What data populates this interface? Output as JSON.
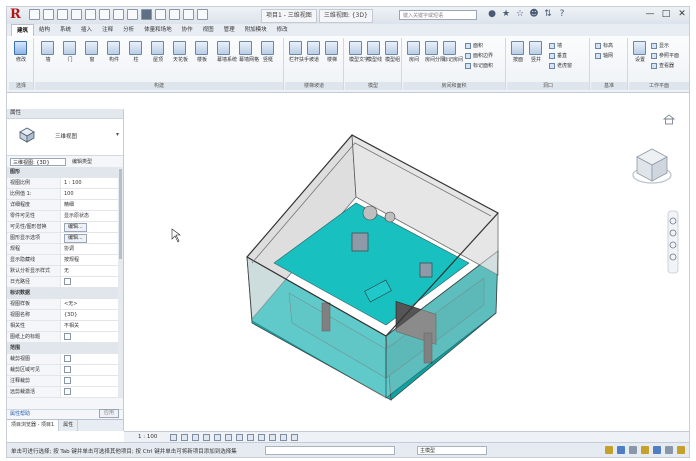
{
  "window": {
    "title_tabs": [
      "项目1 - 三维视图",
      "三维视图: {3D}"
    ],
    "search_placeholder": "键入关键字或短语",
    "user": "登录"
  },
  "ribbon": {
    "tabs": [
      "建筑",
      "结构",
      "系统",
      "插入",
      "注释",
      "分析",
      "体量和场地",
      "协作",
      "视图",
      "管理",
      "附加模块",
      "修改"
    ],
    "active_tab": "建筑",
    "groups": [
      {
        "label": "选择",
        "buttons": [
          "修改"
        ]
      },
      {
        "label": "构建",
        "buttons": [
          "墙",
          "门",
          "窗",
          "构件",
          "柱",
          "屋顶",
          "天花板",
          "楼板",
          "幕墙系统",
          "幕墙网格",
          "竖梃"
        ]
      },
      {
        "label": "楼梯坡道",
        "buttons": [
          "栏杆扶手",
          "坡道",
          "楼梯"
        ]
      },
      {
        "label": "模型",
        "buttons": [
          "模型文字",
          "模型线",
          "模型组"
        ]
      },
      {
        "label": "房间和面积",
        "buttons": [
          "房间",
          "房间分隔",
          "标记房间",
          "面积",
          "面积边界",
          "标记面积"
        ]
      },
      {
        "label": "洞口",
        "buttons": [
          "按面",
          "竖井",
          "墙",
          "垂直",
          "老虎窗"
        ]
      },
      {
        "label": "基准",
        "buttons": [
          "标高",
          "轴网"
        ]
      },
      {
        "label": "工作平面",
        "buttons": [
          "设置",
          "显示",
          "参照平面",
          "查看器"
        ]
      }
    ]
  },
  "properties": {
    "title": "属性",
    "type_name": "三维视图",
    "filter_value": "三维视图: {3D}",
    "edit_type_label": "编辑类型",
    "rows": [
      {
        "type": "section",
        "label": "图形"
      },
      {
        "k": "视图比例",
        "v": "1 : 100"
      },
      {
        "k": "比例值 1:",
        "v": "100"
      },
      {
        "k": "详细程度",
        "v": "精细"
      },
      {
        "k": "零件可见性",
        "v": "显示原状态"
      },
      {
        "k": "可见性/图形替换",
        "v": "编辑..."
      },
      {
        "k": "图形显示选项",
        "v": "编辑..."
      },
      {
        "k": "规程",
        "v": "协调"
      },
      {
        "k": "显示隐藏线",
        "v": "按规程"
      },
      {
        "k": "默认分析显示样式",
        "v": "无"
      },
      {
        "k": "日光路径",
        "v": ""
      },
      {
        "type": "section",
        "label": "标识数据"
      },
      {
        "k": "视图样板",
        "v": "<无>"
      },
      {
        "k": "视图名称",
        "v": "{3D}"
      },
      {
        "k": "相关性",
        "v": "不相关"
      },
      {
        "k": "图纸上的标题",
        "v": ""
      },
      {
        "type": "section",
        "label": "范围"
      },
      {
        "k": "裁剪视图",
        "v": ""
      },
      {
        "k": "裁剪区域可见",
        "v": ""
      },
      {
        "k": "注释裁剪",
        "v": ""
      },
      {
        "k": "远剪裁激活",
        "v": ""
      }
    ],
    "help_link": "属性帮助",
    "apply_label": "应用",
    "bottom_tabs": [
      "项目浏览器 - 项目1",
      "属性"
    ]
  },
  "viewbar": {
    "scale": "1 : 100"
  },
  "status": {
    "text": "单击可进行选择; 按 Tab 键并单击可选择其他项目; 按 Ctrl 键并单击可将新项目添加到选择集",
    "workset": "",
    "model": "主模型"
  },
  "colors": {
    "accent_floor": "#12b3b3",
    "wall_gray": "#c8c8c8",
    "ribbon_blue": "#6d85a6"
  }
}
